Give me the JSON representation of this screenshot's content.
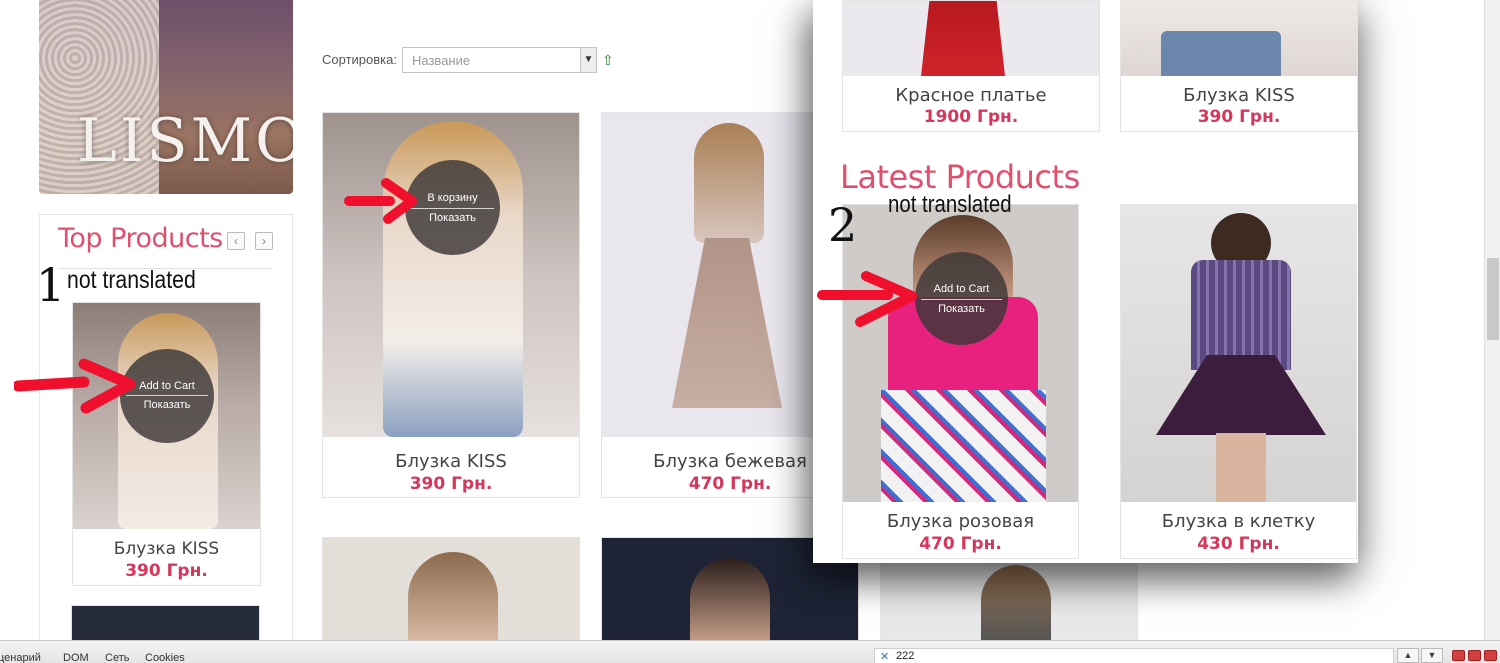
{
  "banner": {
    "logo_text": "LISMO"
  },
  "top_products": {
    "title": "Top Products",
    "prev_icon": "chevron-left-icon",
    "next_icon": "chevron-right-icon",
    "card": {
      "name": "Блузка KISS",
      "price": "390 Грн.",
      "add_to_cart": "Add to Cart",
      "show": "Показать"
    }
  },
  "annotations": {
    "one": {
      "number": "1",
      "text": "not translated"
    },
    "two": {
      "number": "2",
      "text": "not translated"
    },
    "arrow_color": "#f0102e"
  },
  "sorting": {
    "label": "Сортировка:",
    "selected": "Название"
  },
  "products": [
    {
      "name": "Блузка KISS",
      "price": "390 Грн.",
      "add_to_cart": "В корзину",
      "show": "Показать"
    },
    {
      "name": "Блузка бежевая",
      "price": "470 Грн."
    }
  ],
  "overlay": {
    "featured": [
      {
        "name": "Красное платье",
        "price": "1900 Грн."
      },
      {
        "name": "Блузка KISS",
        "price": "390 Грн."
      }
    ],
    "latest_title": "Latest Products",
    "latest": [
      {
        "name": "Блузка розовая",
        "price": "470 Грн.",
        "add_to_cart": "Add to Cart",
        "show": "Показать"
      },
      {
        "name": "Блузка в клетку",
        "price": "430 Грн."
      }
    ]
  },
  "devtools": {
    "tabs": [
      "ценарий",
      "DOM",
      "Сеть",
      "Cookies"
    ],
    "search_value": "222"
  },
  "colors": {
    "accent": "#e0506e",
    "price": "#d6365b"
  }
}
